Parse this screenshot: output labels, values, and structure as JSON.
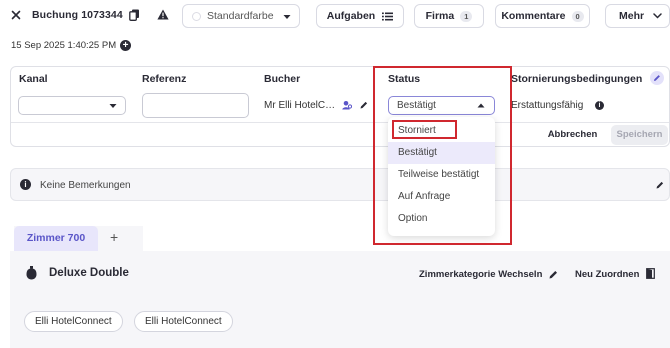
{
  "header": {
    "title": "Buchung 1073344",
    "color_select": "Standardfarbe",
    "buttons": {
      "tasks": "Aufgaben",
      "company": "Firma",
      "company_count": "1",
      "comments": "Kommentare",
      "comments_count": "0",
      "more": "Mehr"
    },
    "timestamp": "15 Sep 2025 1:40:25 PM"
  },
  "table": {
    "headers": {
      "channel": "Kanal",
      "reference": "Referenz",
      "booker": "Bucher",
      "status": "Status",
      "cancellation": "Stornierungsbedingungen"
    },
    "row": {
      "channel": "",
      "reference": "",
      "booker": "Mr Elli HotelC…",
      "status": "Bestätigt",
      "cancellation": "Erstattungsfähig"
    },
    "cancel_label": "Abbrechen",
    "save_label": "Speichern"
  },
  "status_dropdown": {
    "options": [
      "Storniert",
      "Bestätigt",
      "Teilweise bestätigt",
      "Auf Anfrage",
      "Option"
    ],
    "highlighted": "Bestätigt"
  },
  "remarks": {
    "text": "Keine Bemerkungen"
  },
  "room": {
    "tab_label": "Zimmer 700",
    "add_tab": "+",
    "title": "Deluxe Double",
    "change_category": "Zimmerkategorie Wechseln",
    "reassign": "Neu Zuordnen",
    "chips": [
      "Elli HotelConnect",
      "Elli HotelConnect"
    ]
  },
  "colors": {
    "accent": "#5a55c8",
    "highlight_red": "#d0282f",
    "text_dark": "#2a2a35"
  }
}
